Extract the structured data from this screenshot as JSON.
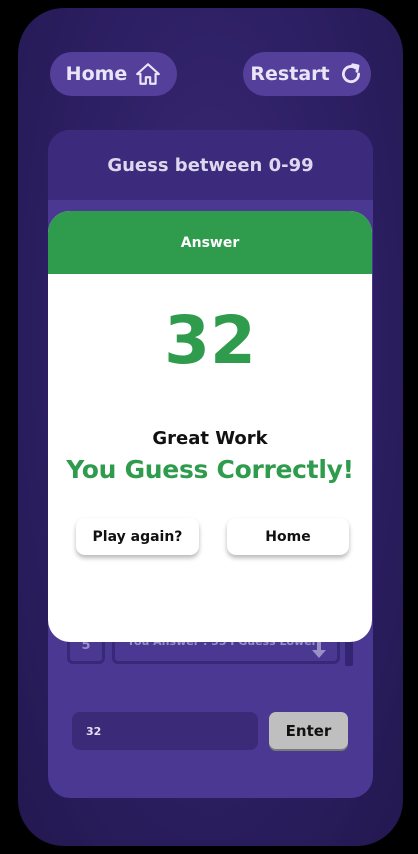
{
  "nav": {
    "home_label": "Home",
    "restart_label": "Restart"
  },
  "game": {
    "title": "Guess between 0-99",
    "input_value": "32",
    "enter_label": "Enter"
  },
  "history": [
    {
      "index": "5",
      "text": "You Answer : 55 I Guess Lower!",
      "icon": "arrow-down-icon"
    }
  ],
  "modal": {
    "header": "Answer",
    "answer": "32",
    "message_line1": "Great Work",
    "message_line2": "You Guess Correctly!",
    "play_again_label": "Play again?",
    "home_label": "Home"
  },
  "colors": {
    "background": "#2d1f63",
    "card": "#4b3893",
    "accent_green": "#2e9b4d",
    "enter_button": "#bfbfbf"
  }
}
